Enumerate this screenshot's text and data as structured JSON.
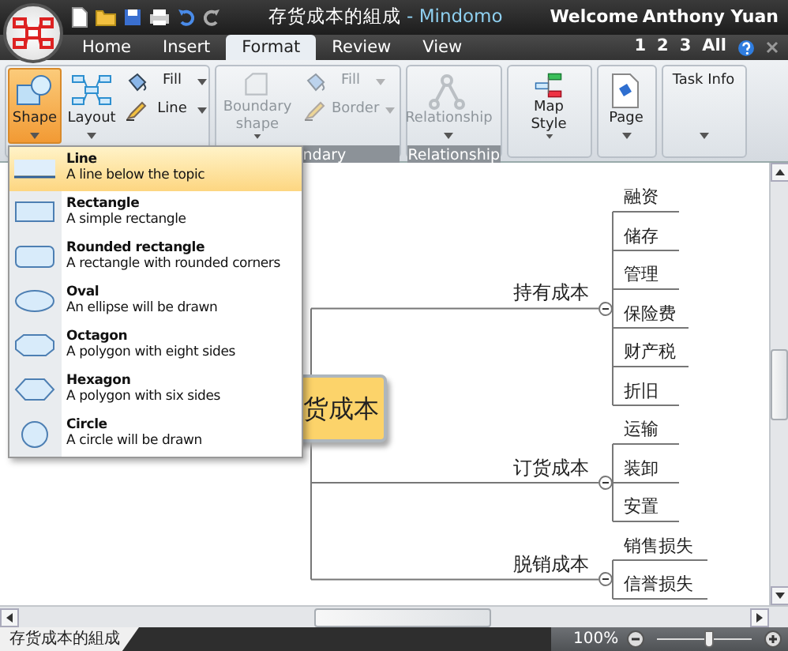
{
  "title_bar": {
    "title": "存货成本的組成",
    "app": "- Mindomo",
    "welcome": "Welcome",
    "user": "Anthony Yuan"
  },
  "tabs": [
    {
      "label": "Home",
      "selected": false
    },
    {
      "label": "Insert",
      "selected": false
    },
    {
      "label": "Format",
      "selected": true
    },
    {
      "label": "Review",
      "selected": false
    },
    {
      "label": "View",
      "selected": false
    }
  ],
  "page_links": [
    "1",
    "2",
    "3",
    "All"
  ],
  "ribbon": {
    "groups": [
      {
        "items": [
          {
            "label": "Shape",
            "kind": "large",
            "pressed": true,
            "disabled": false
          },
          {
            "label": "Layout",
            "kind": "large",
            "pressed": false,
            "disabled": false
          },
          {
            "label": "Fill",
            "kind": "small",
            "pressed": false,
            "disabled": false
          },
          {
            "label": "Line",
            "kind": "small",
            "pressed": false,
            "disabled": false
          }
        ]
      },
      {
        "label": "ndary",
        "items": [
          {
            "label": "Boundary shape",
            "kind": "large",
            "pressed": false,
            "disabled": true
          },
          {
            "label": "Fill",
            "kind": "small",
            "pressed": false,
            "disabled": true
          },
          {
            "label": "Border",
            "kind": "small",
            "pressed": false,
            "disabled": true
          }
        ]
      },
      {
        "label": "Relationship",
        "items": [
          {
            "label": "Relationship",
            "kind": "large",
            "pressed": false,
            "disabled": true
          }
        ]
      },
      {
        "items": [
          {
            "label": "Map Style",
            "kind": "large",
            "pressed": false,
            "disabled": false
          }
        ]
      },
      {
        "items": [
          {
            "label": "Page",
            "kind": "large",
            "pressed": false,
            "disabled": false
          }
        ]
      },
      {
        "items": [
          {
            "label": "Task Info",
            "kind": "large",
            "pressed": false,
            "disabled": false
          }
        ]
      }
    ]
  },
  "shape_menu": {
    "items": [
      {
        "title": "Line",
        "description": "A line below the topic",
        "selected": true
      },
      {
        "title": "Rectangle",
        "description": "A simple rectangle",
        "selected": false
      },
      {
        "title": "Rounded rectangle",
        "description": "A rectangle with rounded corners",
        "selected": false
      },
      {
        "title": "Oval",
        "description": "An ellipse will be drawn",
        "selected": false
      },
      {
        "title": "Octagon",
        "description": "A polygon with eight sides",
        "selected": false
      },
      {
        "title": "Hexagon",
        "description": "A polygon with six sides",
        "selected": false
      },
      {
        "title": "Circle",
        "description": "A circle will be drawn",
        "selected": false
      }
    ]
  },
  "mind_map": {
    "central": "货成本",
    "branches": [
      {
        "label": "持有成本",
        "expanded": true,
        "children": [
          {
            "label": "融资"
          },
          {
            "label": "储存"
          },
          {
            "label": "管理"
          },
          {
            "label": "保险费"
          },
          {
            "label": "财产税"
          },
          {
            "label": "折旧"
          }
        ]
      },
      {
        "label": "订货成本",
        "expanded": true,
        "children": [
          {
            "label": "运输"
          },
          {
            "label": "装卸"
          },
          {
            "label": "安置"
          }
        ]
      },
      {
        "label": "脱销成本",
        "expanded": true,
        "children": [
          {
            "label": "销售损失"
          },
          {
            "label": "信誉损失"
          }
        ]
      }
    ]
  },
  "status_bar": {
    "document": "存货成本的組成",
    "zoom": "100%",
    "zoom_slider": {
      "level": 0.55
    }
  }
}
